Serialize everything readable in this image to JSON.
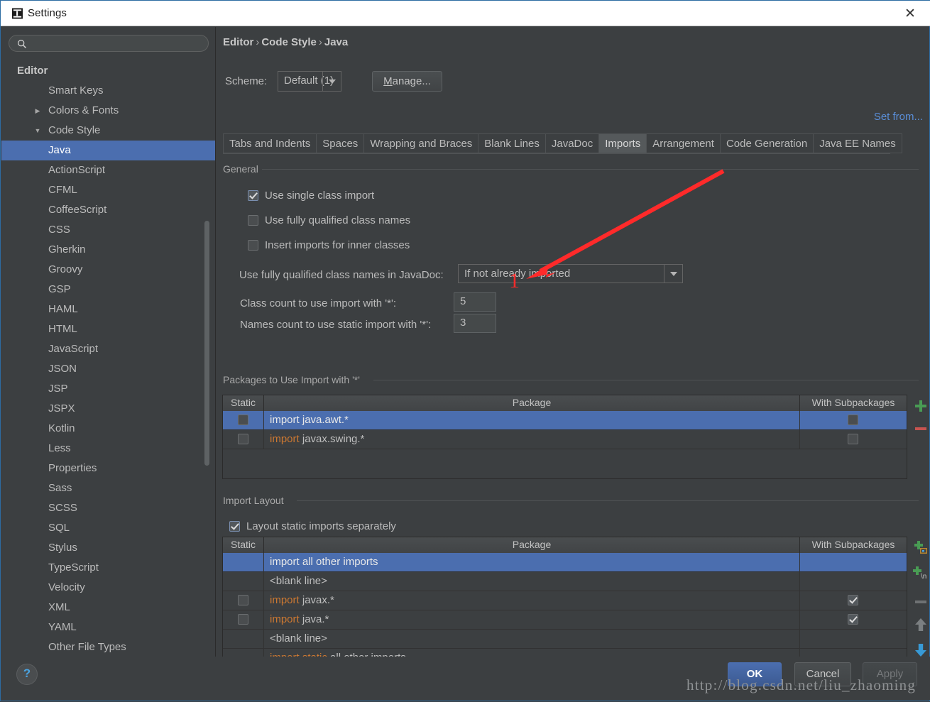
{
  "window": {
    "title": "Settings",
    "app_icon": "intellij-idea-icon",
    "close_icon": "close-icon"
  },
  "sidebar": {
    "search": {
      "placeholder": "",
      "value": "",
      "icon": "search-icon"
    },
    "items": [
      {
        "label": "Editor",
        "level": "root",
        "twisty": "",
        "selected": false
      },
      {
        "label": "Smart Keys",
        "level": "lvl1",
        "twisty": "",
        "selected": false
      },
      {
        "label": "Colors & Fonts",
        "level": "lvl1",
        "twisty": "▶",
        "selected": false
      },
      {
        "label": "Code Style",
        "level": "lvl1",
        "twisty": "▼",
        "selected": false
      },
      {
        "label": "Java",
        "level": "lvl2",
        "twisty": "",
        "selected": true
      },
      {
        "label": "ActionScript",
        "level": "lvl2",
        "twisty": "",
        "selected": false
      },
      {
        "label": "CFML",
        "level": "lvl2",
        "twisty": "",
        "selected": false
      },
      {
        "label": "CoffeeScript",
        "level": "lvl2",
        "twisty": "",
        "selected": false
      },
      {
        "label": "CSS",
        "level": "lvl2",
        "twisty": "",
        "selected": false
      },
      {
        "label": "Gherkin",
        "level": "lvl2",
        "twisty": "",
        "selected": false
      },
      {
        "label": "Groovy",
        "level": "lvl2",
        "twisty": "",
        "selected": false
      },
      {
        "label": "GSP",
        "level": "lvl2",
        "twisty": "",
        "selected": false
      },
      {
        "label": "HAML",
        "level": "lvl2",
        "twisty": "",
        "selected": false
      },
      {
        "label": "HTML",
        "level": "lvl2",
        "twisty": "",
        "selected": false
      },
      {
        "label": "JavaScript",
        "level": "lvl2",
        "twisty": "",
        "selected": false
      },
      {
        "label": "JSON",
        "level": "lvl2",
        "twisty": "",
        "selected": false
      },
      {
        "label": "JSP",
        "level": "lvl2",
        "twisty": "",
        "selected": false
      },
      {
        "label": "JSPX",
        "level": "lvl2",
        "twisty": "",
        "selected": false
      },
      {
        "label": "Kotlin",
        "level": "lvl2",
        "twisty": "",
        "selected": false
      },
      {
        "label": "Less",
        "level": "lvl2",
        "twisty": "",
        "selected": false
      },
      {
        "label": "Properties",
        "level": "lvl2",
        "twisty": "",
        "selected": false
      },
      {
        "label": "Sass",
        "level": "lvl2",
        "twisty": "",
        "selected": false
      },
      {
        "label": "SCSS",
        "level": "lvl2",
        "twisty": "",
        "selected": false
      },
      {
        "label": "SQL",
        "level": "lvl2",
        "twisty": "",
        "selected": false
      },
      {
        "label": "Stylus",
        "level": "lvl2",
        "twisty": "",
        "selected": false
      },
      {
        "label": "TypeScript",
        "level": "lvl2",
        "twisty": "",
        "selected": false
      },
      {
        "label": "Velocity",
        "level": "lvl2",
        "twisty": "",
        "selected": false
      },
      {
        "label": "XML",
        "level": "lvl2",
        "twisty": "",
        "selected": false
      },
      {
        "label": "YAML",
        "level": "lvl2",
        "twisty": "",
        "selected": false
      },
      {
        "label": "Other File Types",
        "level": "lvl2",
        "twisty": "",
        "selected": false
      }
    ]
  },
  "breadcrumb": {
    "part1": "Editor",
    "part2": "Code Style",
    "part3": "Java",
    "separator": "›"
  },
  "scheme": {
    "label": "Scheme:",
    "value": "Default (1)",
    "manage_label_prefix": "",
    "manage_label_underlined": "M",
    "manage_label_rest": "anage...",
    "set_from_label": "Set from..."
  },
  "tabs": [
    {
      "label": "Tabs and Indents",
      "active": false
    },
    {
      "label": "Spaces",
      "active": false
    },
    {
      "label": "Wrapping and Braces",
      "active": false
    },
    {
      "label": "Blank Lines",
      "active": false
    },
    {
      "label": "JavaDoc",
      "active": false
    },
    {
      "label": "Imports",
      "active": true
    },
    {
      "label": "Arrangement",
      "active": false
    },
    {
      "label": "Code Generation",
      "active": false
    },
    {
      "label": "Java EE Names",
      "active": false
    }
  ],
  "general": {
    "title": "General",
    "checkboxes": [
      {
        "label": "Use single class import",
        "checked": true
      },
      {
        "label": "Use fully qualified class names",
        "checked": false
      },
      {
        "label": "Insert imports for inner classes",
        "checked": false
      }
    ],
    "javadoc_field": {
      "label": "Use fully qualified class names in JavaDoc:",
      "value": "If not already imported"
    },
    "class_count": {
      "label": "Class count to use import with '*':",
      "value": "5"
    },
    "names_count": {
      "label": "Names count to use static import with '*':",
      "value": "3"
    }
  },
  "packages_section": {
    "title": "Packages to Use Import with '*'",
    "columns": {
      "static": "Static",
      "package": "Package",
      "subpackages": "With Subpackages"
    },
    "rows": [
      {
        "has_static_cbx": true,
        "static_checked": false,
        "keyword": "import",
        "text": " java.awt.*",
        "has_sub_cbx": true,
        "sub_checked": false,
        "selected": true
      },
      {
        "has_static_cbx": true,
        "static_checked": false,
        "keyword": "import",
        "text": " javax.swing.*",
        "has_sub_cbx": true,
        "sub_checked": false,
        "selected": false
      }
    ],
    "buttons": [
      {
        "name": "add-package-button",
        "icon": "plus-icon"
      },
      {
        "name": "remove-package-button",
        "icon": "minus-icon"
      }
    ]
  },
  "import_layout_section": {
    "title": "Import Layout",
    "checkbox": {
      "label": "Layout static imports separately",
      "checked": true
    },
    "columns": {
      "static": "Static",
      "package": "Package",
      "subpackages": "With Subpackages"
    },
    "rows": [
      {
        "has_static_cbx": false,
        "static_checked": false,
        "keyword": "import",
        "text": " all other imports",
        "has_sub_cbx": false,
        "sub_checked": false,
        "selected": true
      },
      {
        "has_static_cbx": false,
        "static_checked": false,
        "keyword": "",
        "text": "<blank line>",
        "has_sub_cbx": false,
        "sub_checked": false,
        "selected": false
      },
      {
        "has_static_cbx": true,
        "static_checked": false,
        "keyword": "import",
        "text": " javax.*",
        "has_sub_cbx": true,
        "sub_checked": true,
        "selected": false
      },
      {
        "has_static_cbx": true,
        "static_checked": false,
        "keyword": "import",
        "text": " java.*",
        "has_sub_cbx": true,
        "sub_checked": true,
        "selected": false
      },
      {
        "has_static_cbx": false,
        "static_checked": false,
        "keyword": "",
        "text": "<blank line>",
        "has_sub_cbx": false,
        "sub_checked": false,
        "selected": false
      },
      {
        "has_static_cbx": false,
        "static_checked": false,
        "keyword": "import static",
        "text": " all other imports",
        "has_sub_cbx": false,
        "sub_checked": false,
        "selected": false
      }
    ],
    "buttons": [
      {
        "name": "add-package-entry-button",
        "icon": "plus-package-icon"
      },
      {
        "name": "add-blank-line-button",
        "icon": "plus-newline-icon"
      },
      {
        "name": "remove-entry-button",
        "icon": "minus-icon"
      },
      {
        "name": "move-up-button",
        "icon": "arrow-up-icon"
      },
      {
        "name": "move-down-button",
        "icon": "arrow-down-icon"
      }
    ]
  },
  "footer": {
    "help_icon": "question-mark-icon",
    "ok_label": "OK",
    "cancel_label": "Cancel",
    "apply_label": "Apply"
  },
  "annotation": {
    "number": "1",
    "color": "#ff2a2a",
    "arrow": "red-arrow-annotation"
  },
  "watermark": {
    "text": "http://blog.csdn.net/liu_zhaoming"
  },
  "colors": {
    "window_bg": "#3c3f41",
    "titlebar_bg": "#ffffff",
    "selection": "#4b6eaf",
    "keyword_orange": "#cc7832",
    "link_blue": "#5a8ed8",
    "accent_green": "#499c54",
    "accent_red": "#c75450"
  }
}
